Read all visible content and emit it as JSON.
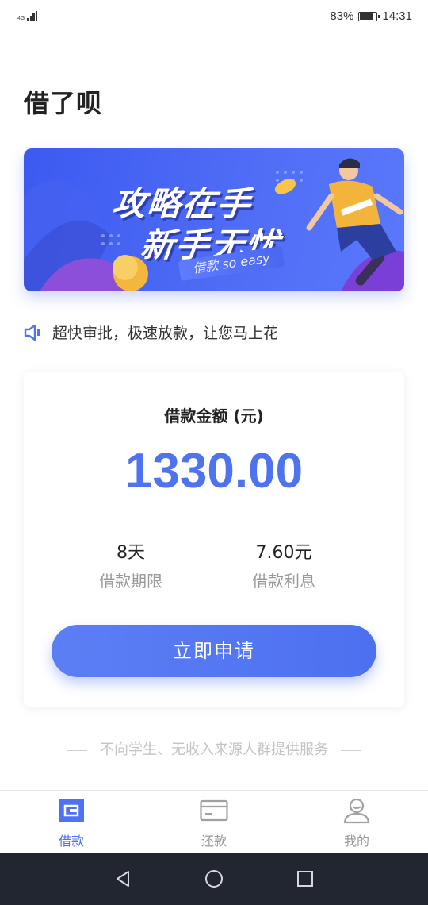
{
  "status_bar": {
    "network": "4G",
    "battery_percent": "83%",
    "battery_level": 0.83,
    "time": "14:31"
  },
  "page": {
    "title": "借了呗"
  },
  "banner": {
    "headline_line1": "攻略在手",
    "headline_line2": "新手无忧",
    "tag": "借款 so easy"
  },
  "notice": {
    "icon": "speaker-icon",
    "text": "超快审批，极速放款，让您马上花"
  },
  "loan_card": {
    "amount_label": "借款金额 (元)",
    "amount_value": "1330.00",
    "term_value": "8天",
    "term_label": "借款期限",
    "interest_value": "7.60元",
    "interest_label": "借款利息",
    "apply_button": "立即申请"
  },
  "footnote": "不向学生、无收入来源人群提供服务",
  "tab_bar": {
    "items": [
      {
        "label": "借款",
        "icon": "loan-icon",
        "active": true
      },
      {
        "label": "还款",
        "icon": "card-icon",
        "active": false
      },
      {
        "label": "我的",
        "icon": "user-icon",
        "active": false
      }
    ]
  },
  "colors": {
    "accent": "#4f73f0",
    "muted_text": "#999999",
    "nav_bar": "#222630"
  }
}
